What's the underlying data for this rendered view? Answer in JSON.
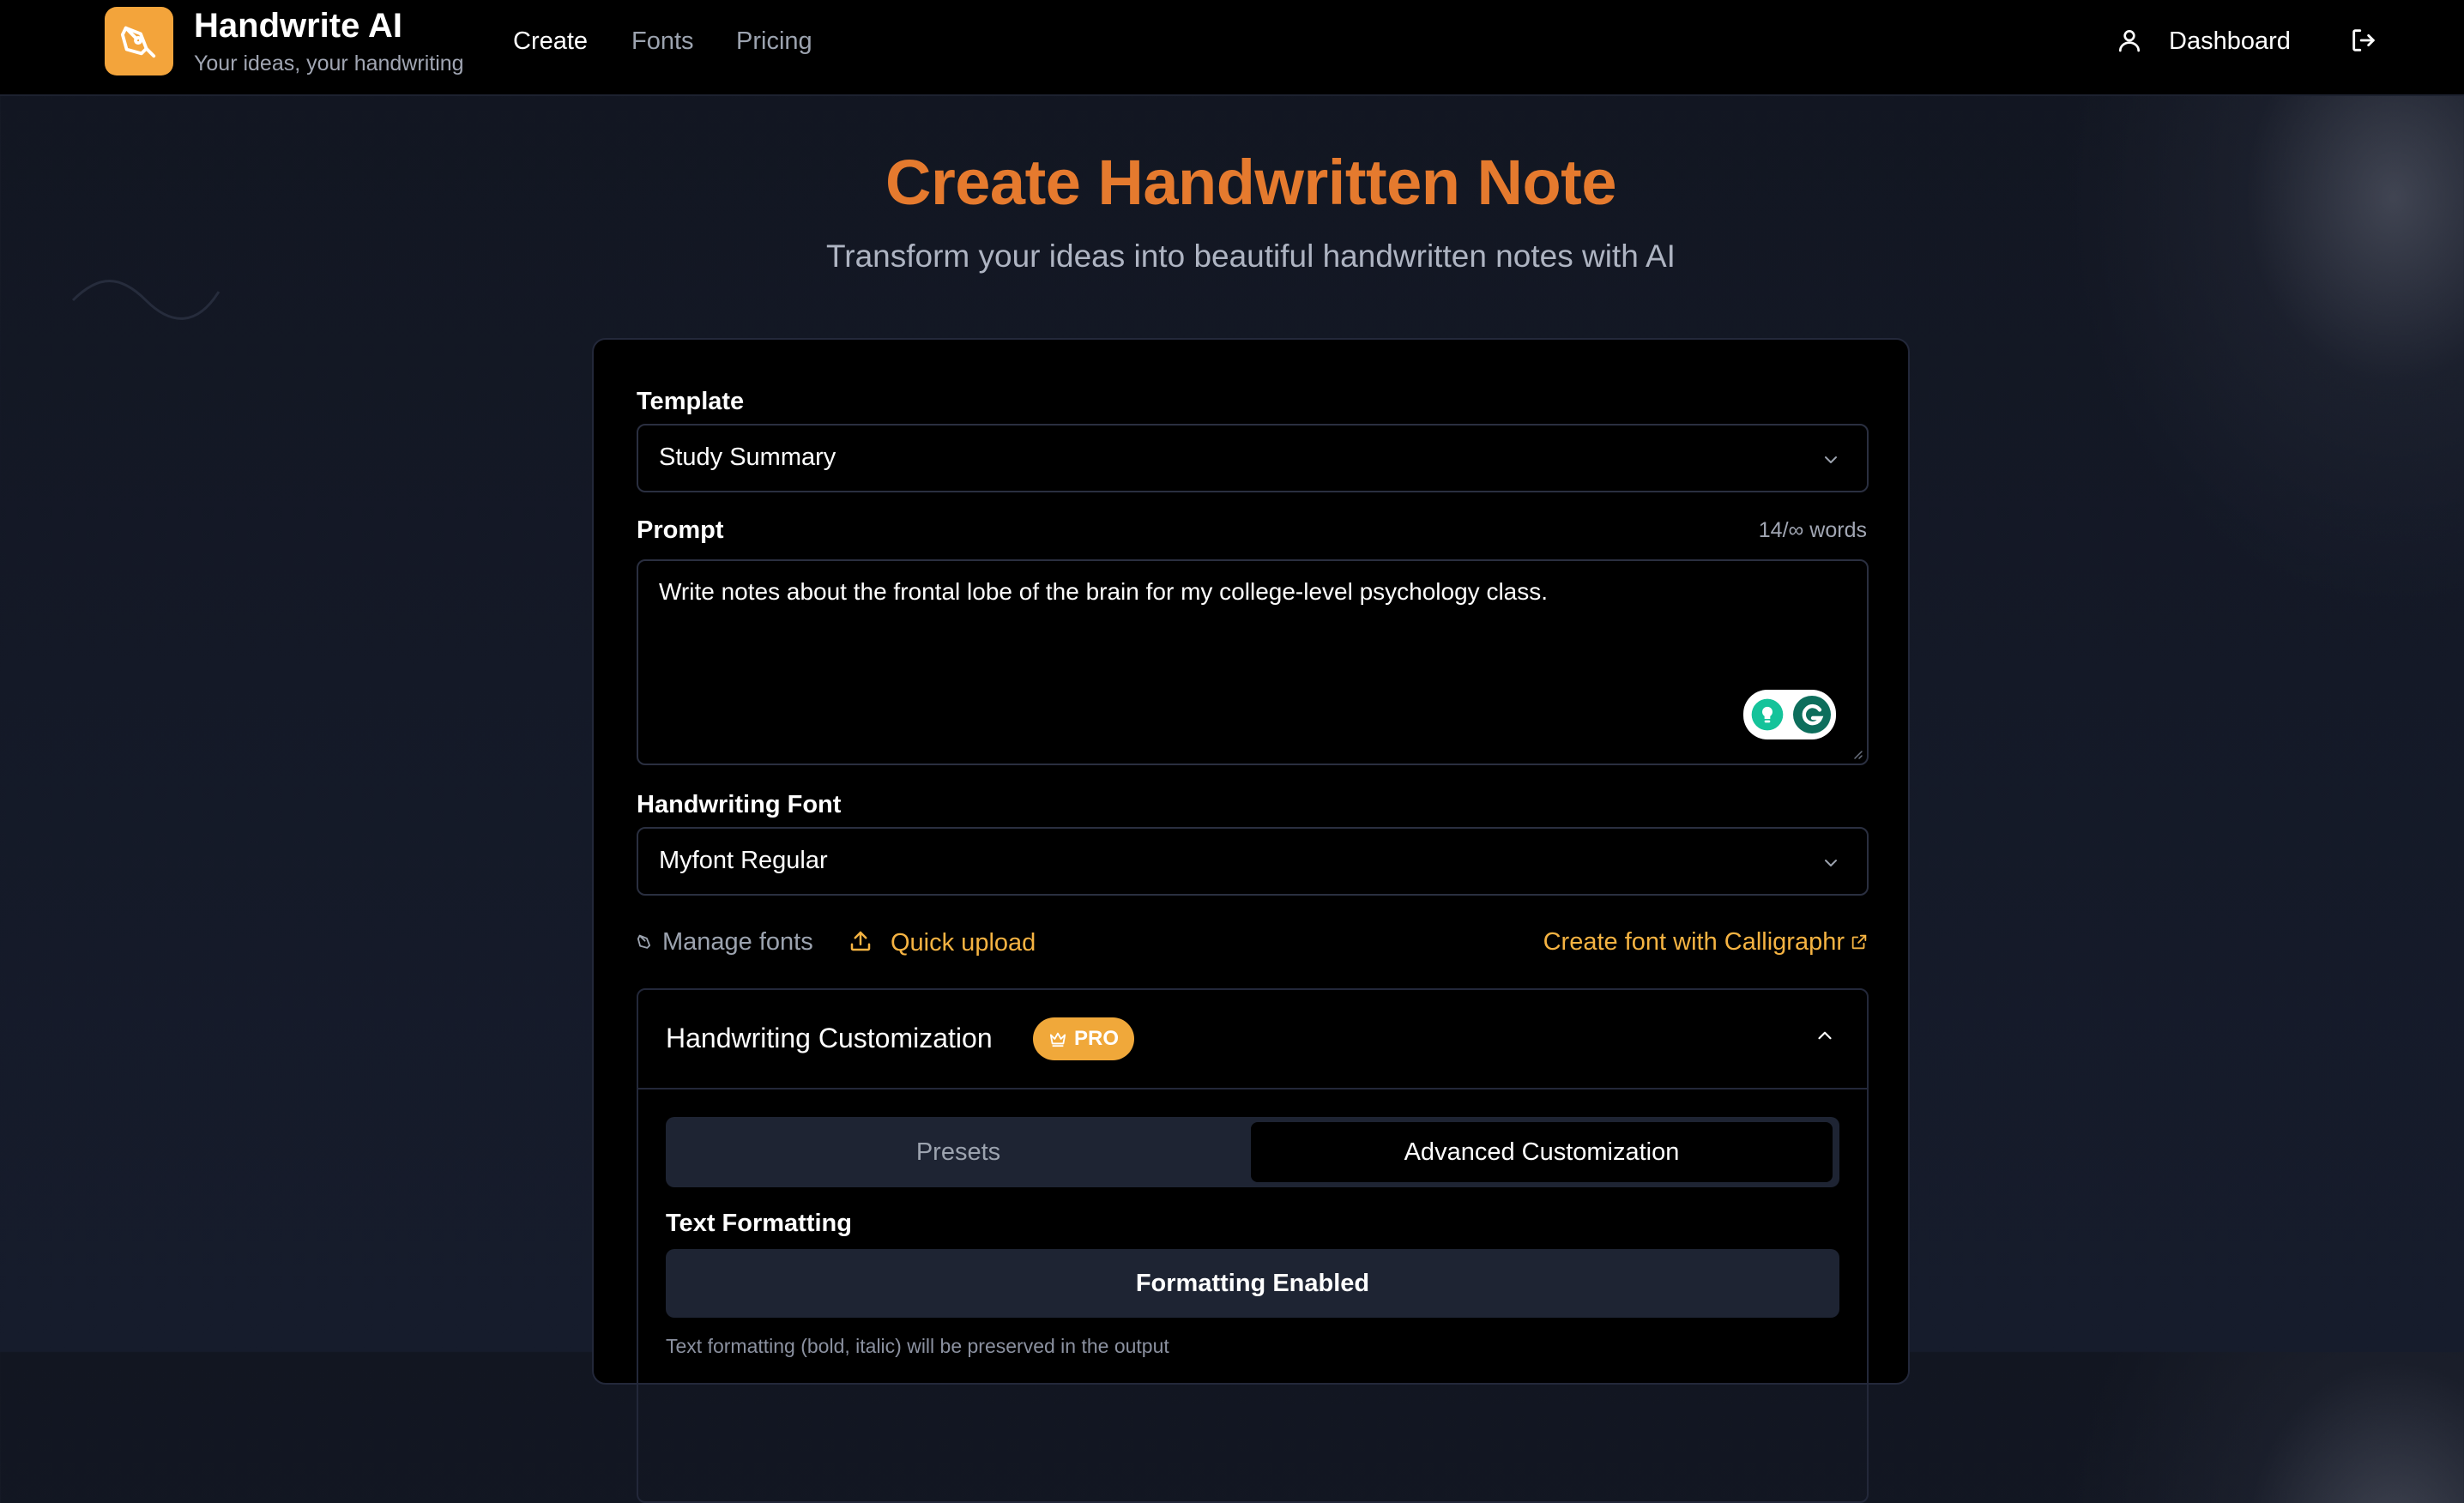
{
  "brand": {
    "title": "Handwrite AI",
    "subtitle": "Your ideas, your handwriting",
    "accent": "#f3a43b"
  },
  "nav": {
    "items": [
      {
        "label": "Create",
        "active": true
      },
      {
        "label": "Fonts",
        "active": false
      },
      {
        "label": "Pricing",
        "active": false
      }
    ],
    "dashboard_label": "Dashboard",
    "icons": [
      "user-icon",
      "logout-icon"
    ]
  },
  "hero": {
    "title": "Create Handwritten Note",
    "subtitle": "Transform your ideas into beautiful handwritten notes with AI",
    "title_color": "#e57a2e"
  },
  "form": {
    "template": {
      "label": "Template",
      "selected": "Study Summary"
    },
    "prompt": {
      "label": "Prompt",
      "word_count": "14/∞ words",
      "value": "Write notes about the frontal lobe of the brain for my college-level psychology class."
    },
    "font": {
      "label": "Handwriting Font",
      "selected": "Myfont Regular"
    },
    "font_actions": {
      "manage": "Manage fonts",
      "upload": "Quick upload",
      "calligraphr": "Create font with Calligraphr"
    },
    "customization": {
      "title": "Handwriting Customization",
      "badge": "PRO",
      "expanded": true,
      "tabs": [
        {
          "label": "Presets",
          "active": false
        },
        {
          "label": "Advanced Customization",
          "active": true
        }
      ],
      "text_formatting": {
        "label": "Text Formatting",
        "toggle_label": "Formatting Enabled",
        "note": "Text formatting (bold, italic) will be preserved in the output"
      }
    }
  }
}
